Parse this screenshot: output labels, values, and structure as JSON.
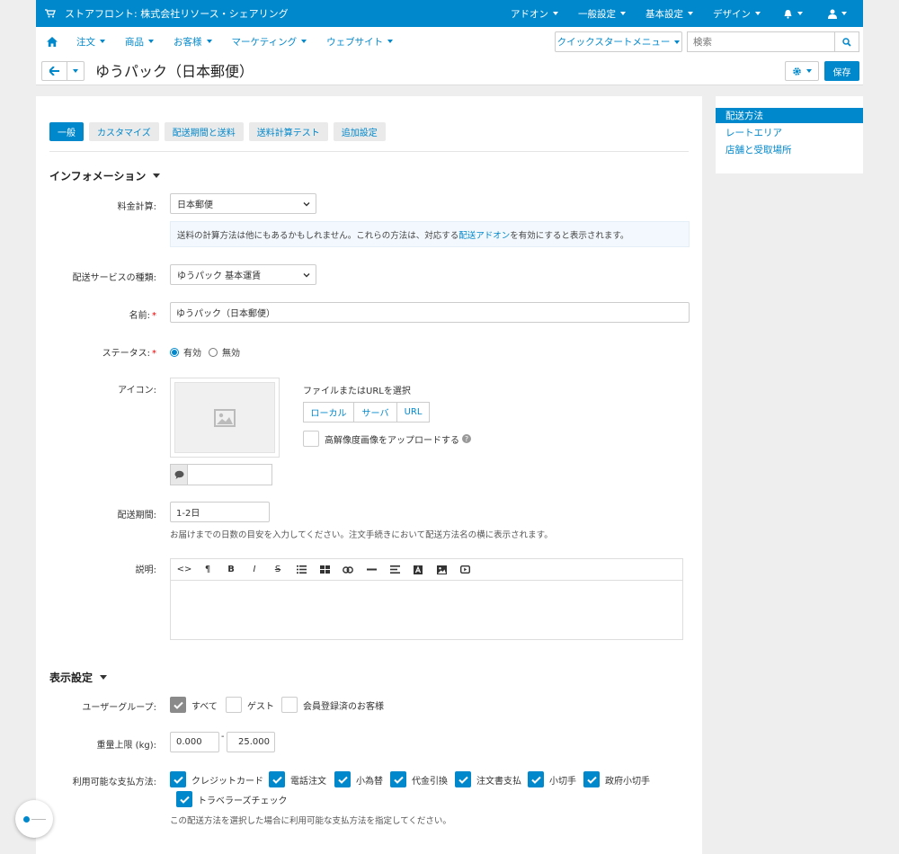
{
  "topbar": {
    "store": "ストアフロント: 株式会社リソース・シェアリング",
    "menus": [
      "アドオン",
      "一般設定",
      "基本設定",
      "デザイン"
    ]
  },
  "nav": {
    "items": [
      "注文",
      "商品",
      "お客様",
      "マーケティング",
      "ウェブサイト"
    ],
    "quickstart": "クイックスタートメニュー",
    "search_placeholder": "検索"
  },
  "page": {
    "title": "ゆうパック（日本郵便）",
    "save": "保存"
  },
  "tabs": [
    "一般",
    "カスタマイズ",
    "配送期間と送料",
    "送料計算テスト",
    "追加設定"
  ],
  "info": {
    "section": "インフォメーション",
    "rate_label": "料金計算:",
    "rate_value": "日本郵便",
    "note_before": "送料の計算方法は他にもあるかもしれません。これらの方法は、対応する",
    "note_link": "配送アドオン",
    "note_after": "を有効にすると表示されます。",
    "service_label": "配送サービスの種類:",
    "service_value": "ゆうパック 基本運賃",
    "name_label": "名前:",
    "name_value": "ゆうパック（日本郵便）",
    "req": "*",
    "status_label": "ステータス:",
    "status_on": "有効",
    "status_off": "無効",
    "icon_label": "アイコン:",
    "file_label": "ファイルまたはURLを選択",
    "file_buttons": [
      "ローカル",
      "サーバ",
      "URL"
    ],
    "hires_label": "高解像度画像をアップロードする",
    "help": "?",
    "period_label": "配送期間:",
    "period_value": "1-2日",
    "period_hint": "お届けまでの日数の目安を入力してください。注文手続きにおいて配送方法名の横に表示されます。",
    "desc_label": "説明:",
    "toolbar": [
      "<>",
      "¶",
      "B",
      "I",
      "S"
    ]
  },
  "display": {
    "section": "表示設定",
    "usergroup_label": "ユーザーグループ:",
    "usergroups": [
      "すべて",
      "ゲスト",
      "会員登録済のお客様"
    ],
    "weight_label": "重量上限 (kg):",
    "weight_min": "0.000",
    "weight_sep": "-",
    "weight_max": "25.000",
    "payment_label": "利用可能な支払方法:",
    "payments": [
      "クレジットカード",
      "電話注文",
      "小為替",
      "代金引換",
      "注文書支払",
      "小切手",
      "政府小切手",
      "トラベラーズチェック"
    ],
    "payment_hint": "この配送方法を選択した場合に利用可能な支払方法を指定してください。"
  },
  "side": {
    "items": [
      "配送方法",
      "レートエリア",
      "店舗と受取場所"
    ]
  },
  "colors": {
    "brand": "#0088cc"
  }
}
